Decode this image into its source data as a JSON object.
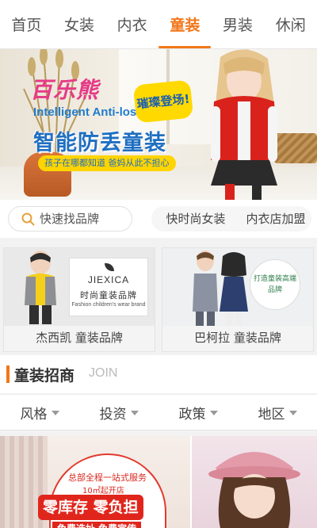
{
  "tabs": [
    {
      "label": "首页",
      "active": false
    },
    {
      "label": "女装",
      "active": false
    },
    {
      "label": "内衣",
      "active": false
    },
    {
      "label": "童装",
      "active": true
    },
    {
      "label": "男装",
      "active": false
    },
    {
      "label": "休闲",
      "active": false
    }
  ],
  "accent_color": "#f2771a",
  "banner": {
    "logo": "百乐熊",
    "english": "Intelligent Anti-lost",
    "chinese": "智能防丢童装",
    "subtitle": "孩子在哪都知道 爸妈从此不担心",
    "bubble": "璀璨登场!",
    "slide_count": 5,
    "active_slide": 1
  },
  "search": {
    "placeholder": "快速找品牌",
    "icon": "search-icon"
  },
  "quick_links": [
    "快时尚女装",
    "内衣店加盟"
  ],
  "brands": [
    {
      "caption": "杰西凯 童装品牌",
      "board_name": "JIEXICA",
      "board_cn": "时尚童装品牌",
      "board_en": "Fashion children's wear brand"
    },
    {
      "caption": "巴柯拉 童装品牌",
      "board_cn": "打造童装高端品牌"
    }
  ],
  "section": {
    "title": "童装招商",
    "subtitle": "JOIN"
  },
  "filters": [
    "风格",
    "投资",
    "政策",
    "地区"
  ],
  "promo": {
    "line1": "总部全程一站式服务",
    "line2": "10㎡起开店",
    "headline": "零库存 零负担",
    "line3": "免费选址 免费宣传"
  }
}
